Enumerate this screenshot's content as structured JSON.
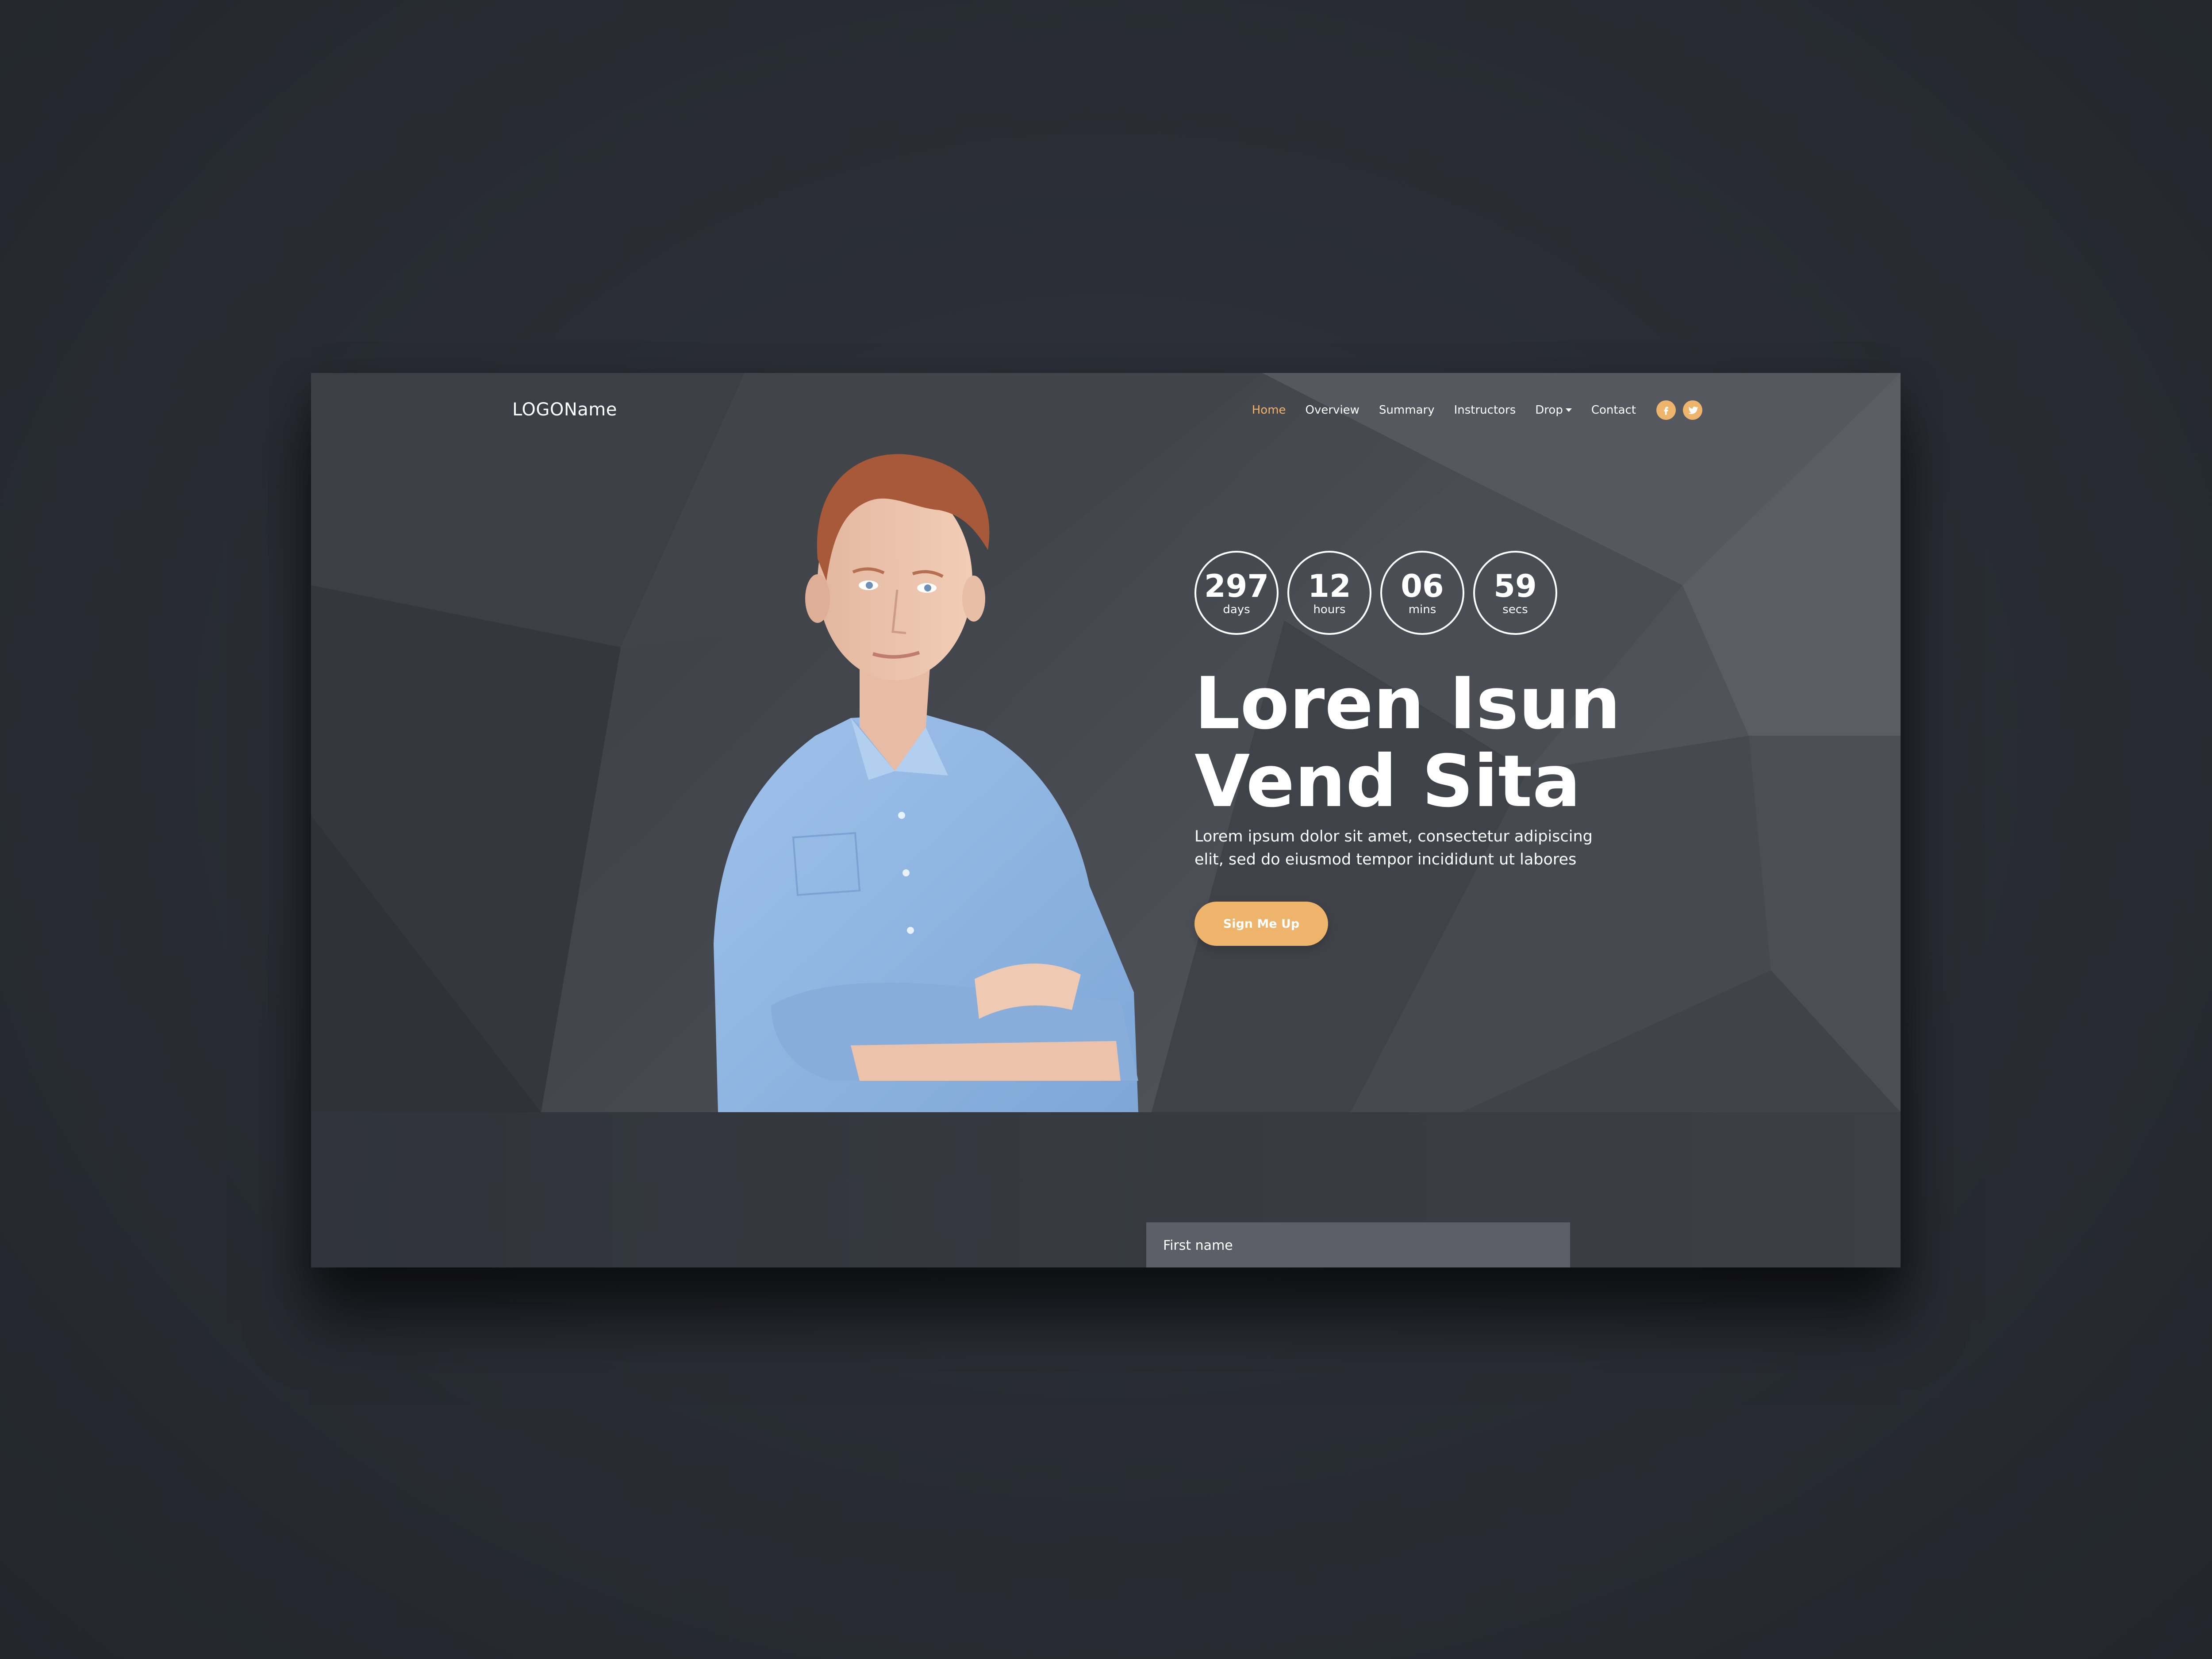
{
  "colors": {
    "accent": "#efb46b",
    "text": "#ffffff",
    "hero_bg": "#43464d",
    "page_bg": "#2a2d35"
  },
  "navbar": {
    "logo": "LOGOName",
    "links": [
      "Home",
      "Overview",
      "Summary",
      "Instructors",
      "Drop",
      "Contact"
    ],
    "active": "Home",
    "social": [
      "facebook-icon",
      "twitter-icon"
    ]
  },
  "countdown": [
    {
      "value": "297",
      "unit": "days"
    },
    {
      "value": "12",
      "unit": "hours"
    },
    {
      "value": "06",
      "unit": "mins"
    },
    {
      "value": "59",
      "unit": "secs"
    }
  ],
  "hero": {
    "headline_line1": "Loren Isun",
    "headline_line2": "Vend Sita",
    "tagline_line1": "Lorem ipsum dolor sit amet, consectetur adipiscing",
    "tagline_line2": "elit, sed do eiusmod tempor incididunt ut labores",
    "cta_label": "Sign Me Up"
  },
  "form": {
    "first_name_placeholder": "First name"
  }
}
